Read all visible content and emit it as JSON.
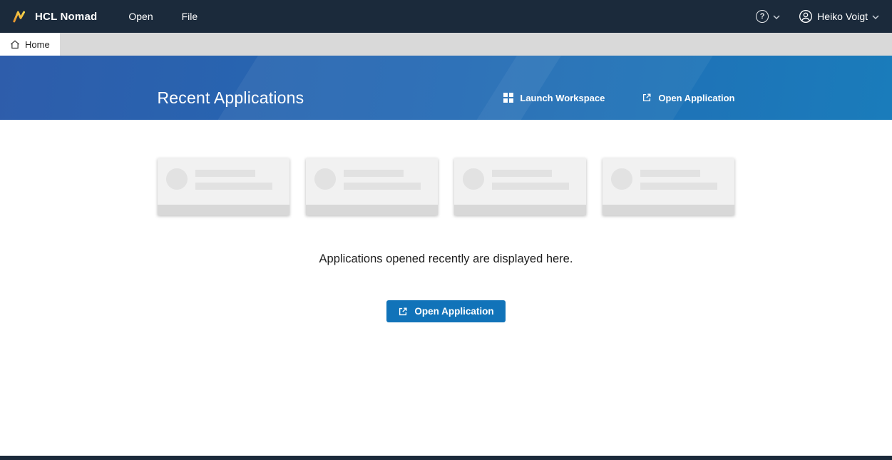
{
  "topbar": {
    "brand": "HCL Nomad",
    "menu": [
      {
        "label": "Open"
      },
      {
        "label": "File"
      }
    ],
    "user_name": "Heiko Voigt"
  },
  "tabbar": {
    "home_label": "Home"
  },
  "hero": {
    "title": "Recent Applications",
    "launch_workspace_label": "Launch Workspace",
    "open_application_label": "Open Application"
  },
  "content": {
    "empty_message": "Applications opened recently are displayed here.",
    "open_application_button": "Open Application",
    "placeholder_card_count": 4
  },
  "colors": {
    "topbar": "#1b2a3b",
    "hero_start": "#2e5dab",
    "hero_end": "#1a7cbb",
    "accent_button": "#1173b9"
  }
}
